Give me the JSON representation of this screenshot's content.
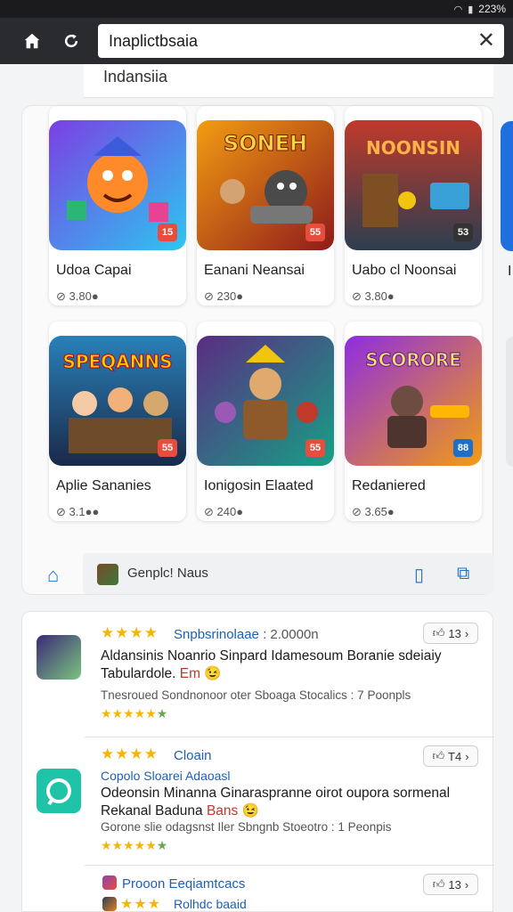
{
  "status": {
    "battery": "223%"
  },
  "browser": {
    "url": "Inaplictbsaia",
    "suggestion": "Indansiia"
  },
  "games": [
    {
      "title": "Udoa Capai",
      "meta": "3.80●",
      "badge": "15"
    },
    {
      "title": "Eanani Neansai",
      "meta": "230●",
      "badge": "55"
    },
    {
      "title": "Uabo cl Noonsai",
      "meta": "3.80●",
      "badge": "53"
    },
    {
      "title": "Aplie Sananies",
      "meta": "3.1●●",
      "badge": "55"
    },
    {
      "title": "Ionigosin Elaated",
      "meta": "240●",
      "badge": "55"
    },
    {
      "title": "Redaniered",
      "meta": "3.65●",
      "badge": "88"
    }
  ],
  "partial_card_label": "I",
  "panel_bar": {
    "label": "Genplc! Naus"
  },
  "reviews": [
    {
      "author": "Snpbsrinolaae",
      "author_sub": ": 2.0000n",
      "likes": "13",
      "line1": "Aldansinis Noanrio Sinpard Idamesoum Boranie sdeiaiy",
      "line2_text": "Tabulardole.",
      "line2_em": "Em",
      "footer": "Tnesroued Sondnonoor oter Sboaga Stocalics : 7 Poonpls"
    },
    {
      "author": "Cloain",
      "likes": "T4",
      "tagline": "Copolo Sloarei Adaoasl",
      "line1": "Odeonsin Minanna Ginaraspranne oirot oupora sormenal",
      "line2_text": "Rekanal Baduna",
      "line2_em": "Bans",
      "footer": "Gorone slie odagsnst Iler Sbngnb Stoeotro : 1 Peonpis"
    },
    {
      "author": "Prooon Eeqiamtcacs",
      "likes": "13",
      "tagline": "Rolhdc baaid"
    }
  ],
  "colors": {
    "accent": "#1e6fc8",
    "star": "#f2b705",
    "browser_bar": "#2a2b2e"
  }
}
